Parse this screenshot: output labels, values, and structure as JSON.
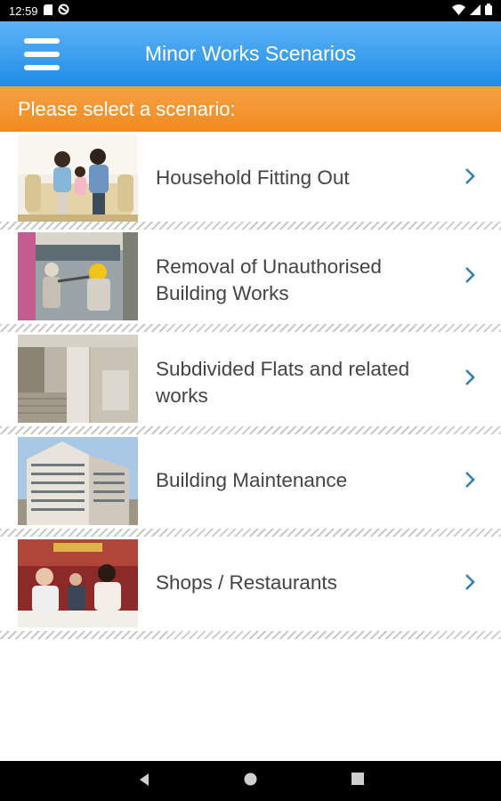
{
  "status_bar": {
    "time": "12:59",
    "icons": [
      "sd-card-icon",
      "sync-icon",
      "wifi-icon",
      "cellular-icon",
      "battery-icon"
    ]
  },
  "app_bar": {
    "title": "Minor Works Scenarios",
    "menu_icon": "hamburger-menu-icon",
    "color_top": "#5eb3f6",
    "color_bottom": "#1f8de8"
  },
  "prompt": {
    "text": "Please select a scenario:",
    "color": "#f29130"
  },
  "scenarios": [
    {
      "label": "Household Fitting Out",
      "thumbnail": "family-living-room-photo"
    },
    {
      "label": "Removal of Unauthorised Building Works",
      "thumbnail": "worker-removing-structure-photo"
    },
    {
      "label": "Subdivided Flats and related works",
      "thumbnail": "subdivided-flat-interior-photo"
    },
    {
      "label": "Building Maintenance",
      "thumbnail": "residential-tower-photo"
    },
    {
      "label": "Shops / Restaurants",
      "thumbnail": "restaurant-diners-photo"
    }
  ],
  "chevron_color": "#2a7fb8",
  "nav_bar": {
    "buttons": [
      "back-icon",
      "home-icon",
      "recents-icon"
    ]
  }
}
